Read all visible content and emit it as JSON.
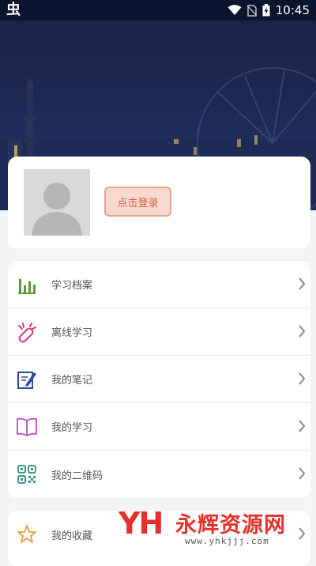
{
  "status_bar": {
    "app_glyph": "虫",
    "time": "10:45",
    "icons": [
      "wifi-icon",
      "no-sim-icon",
      "battery-charging-icon"
    ]
  },
  "profile": {
    "avatar_icon": "default-user-avatar-icon",
    "login_label": "点击登录"
  },
  "menu": {
    "items": [
      {
        "label": "学习档案",
        "icon": "bar-chart-icon",
        "color": "#5a9a3a"
      },
      {
        "label": "离线学习",
        "icon": "offline-link-icon",
        "color": "#d33a78"
      },
      {
        "label": "我的笔记",
        "icon": "notebook-pen-icon",
        "color": "#2a4c9c"
      },
      {
        "label": "我的学习",
        "icon": "open-book-icon",
        "color": "#c45ac8"
      },
      {
        "label": "我的二维码",
        "icon": "qr-code-icon",
        "color": "#3a9a8a"
      }
    ]
  },
  "favorites": {
    "label": "我的收藏",
    "icon": "star-icon",
    "color": "#e3a13a"
  },
  "watermark": {
    "logo": "YH",
    "title": "永辉资源网",
    "url": "www.yhkjjj.com"
  }
}
